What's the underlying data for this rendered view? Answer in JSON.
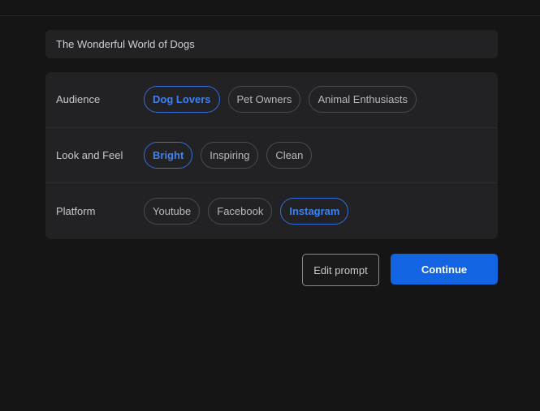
{
  "prompt": {
    "text": "The Wonderful World of Dogs"
  },
  "options": [
    {
      "label": "Audience",
      "chips": [
        {
          "label": "Dog Lovers",
          "selected": true
        },
        {
          "label": "Pet Owners",
          "selected": false
        },
        {
          "label": "Animal Enthusiasts",
          "selected": false
        }
      ]
    },
    {
      "label": "Look and Feel",
      "chips": [
        {
          "label": "Bright",
          "selected": true
        },
        {
          "label": "Inspiring",
          "selected": false
        },
        {
          "label": "Clean",
          "selected": false
        }
      ]
    },
    {
      "label": "Platform",
      "chips": [
        {
          "label": "Youtube",
          "selected": false
        },
        {
          "label": "Facebook",
          "selected": false
        },
        {
          "label": "Instagram",
          "selected": true
        }
      ]
    }
  ],
  "actions": {
    "edit_label": "Edit prompt",
    "continue_label": "Continue"
  },
  "colors": {
    "accent": "#1264e3",
    "selected_text": "#3d82f5",
    "background": "#151516",
    "card": "#222224"
  }
}
